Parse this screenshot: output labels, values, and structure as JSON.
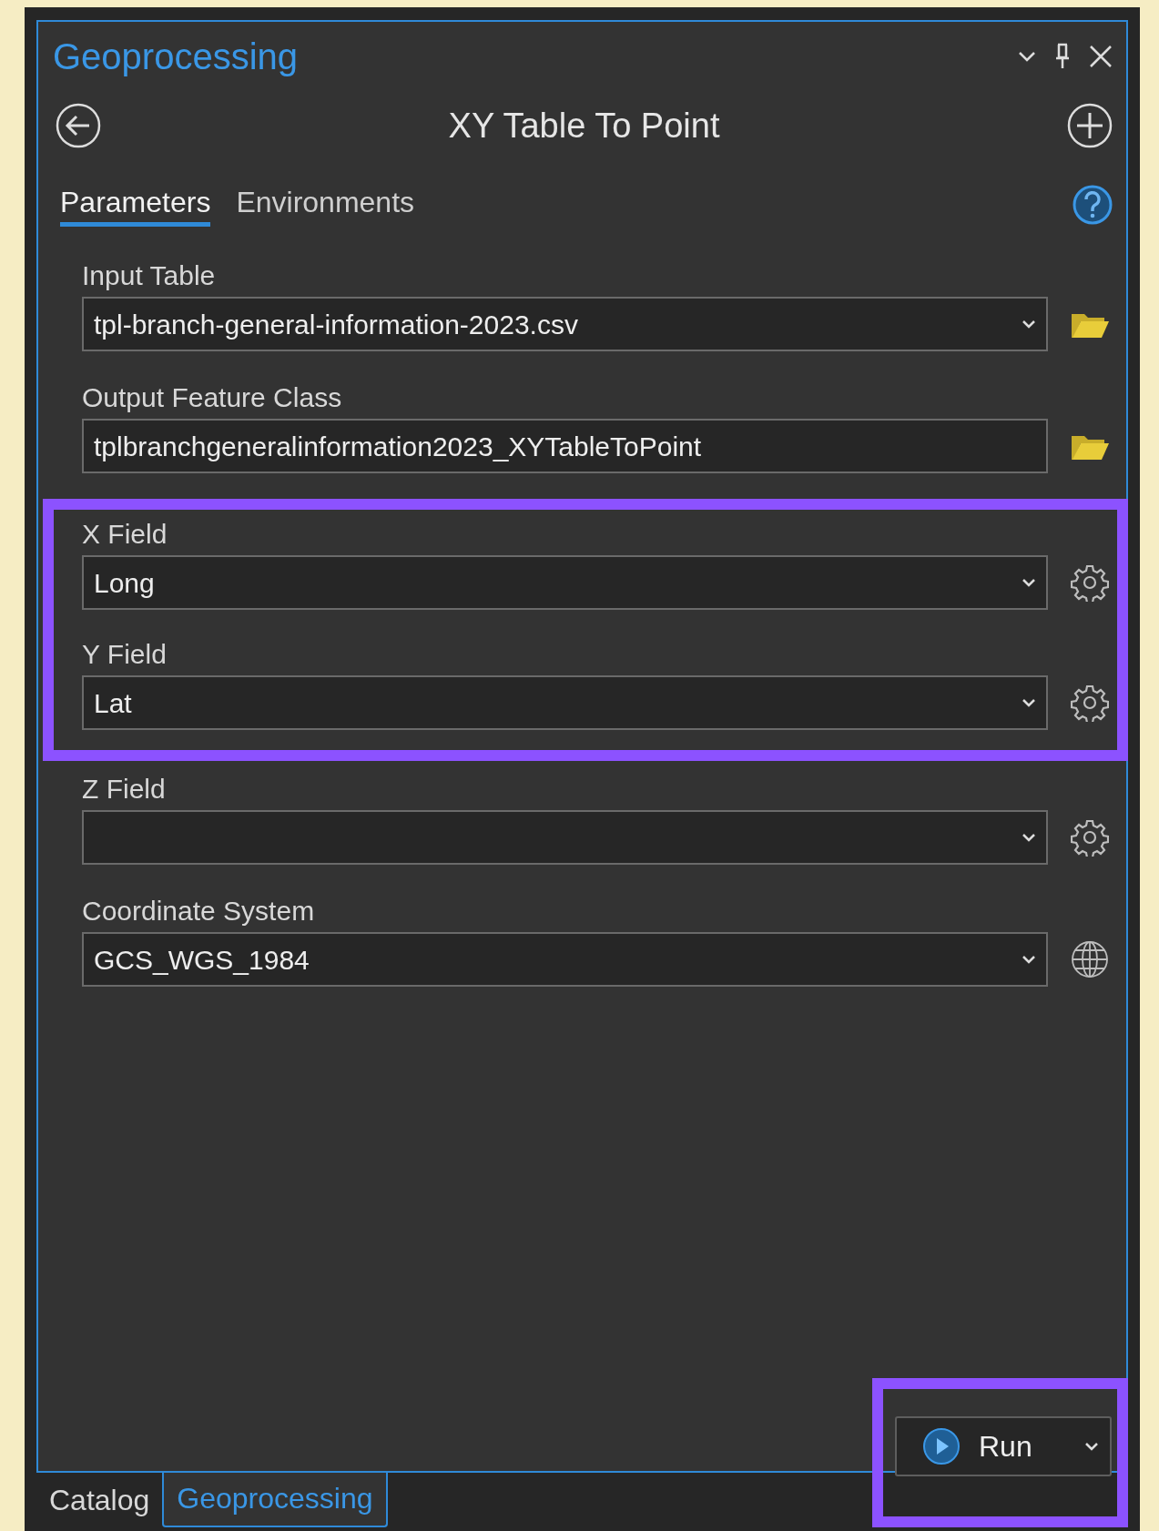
{
  "pane": {
    "title": "Geoprocessing",
    "tool_title": "XY Table To Point"
  },
  "tabs": [
    {
      "label": "Parameters",
      "selected": true
    },
    {
      "label": "Environments",
      "selected": false
    }
  ],
  "parameters": [
    {
      "label": "Input Table",
      "kind": "table",
      "value": "tpl-branch-general-information-2023.csv",
      "highlighted": false
    },
    {
      "label": "Output Feature Class",
      "kind": "output",
      "value": "tplbranchgeneralinformation2023_XYTableToPoint",
      "highlighted": false
    },
    {
      "label": "X Field",
      "kind": "field",
      "value": "Long",
      "highlighted": true
    },
    {
      "label": "Y Field",
      "kind": "field",
      "value": "Lat",
      "highlighted": true
    },
    {
      "label": "Z Field",
      "kind": "field",
      "highlighted": false
    },
    {
      "label": "Coordinate System",
      "kind": "spatial",
      "value": "GCS_WGS_1984",
      "highlighted": false
    }
  ],
  "run_button": {
    "label": "Run",
    "highlighted": true
  },
  "bottom_tabs": [
    {
      "label": "Catalog",
      "selected": false
    },
    {
      "label": "Geoprocessing",
      "selected": true
    }
  ]
}
